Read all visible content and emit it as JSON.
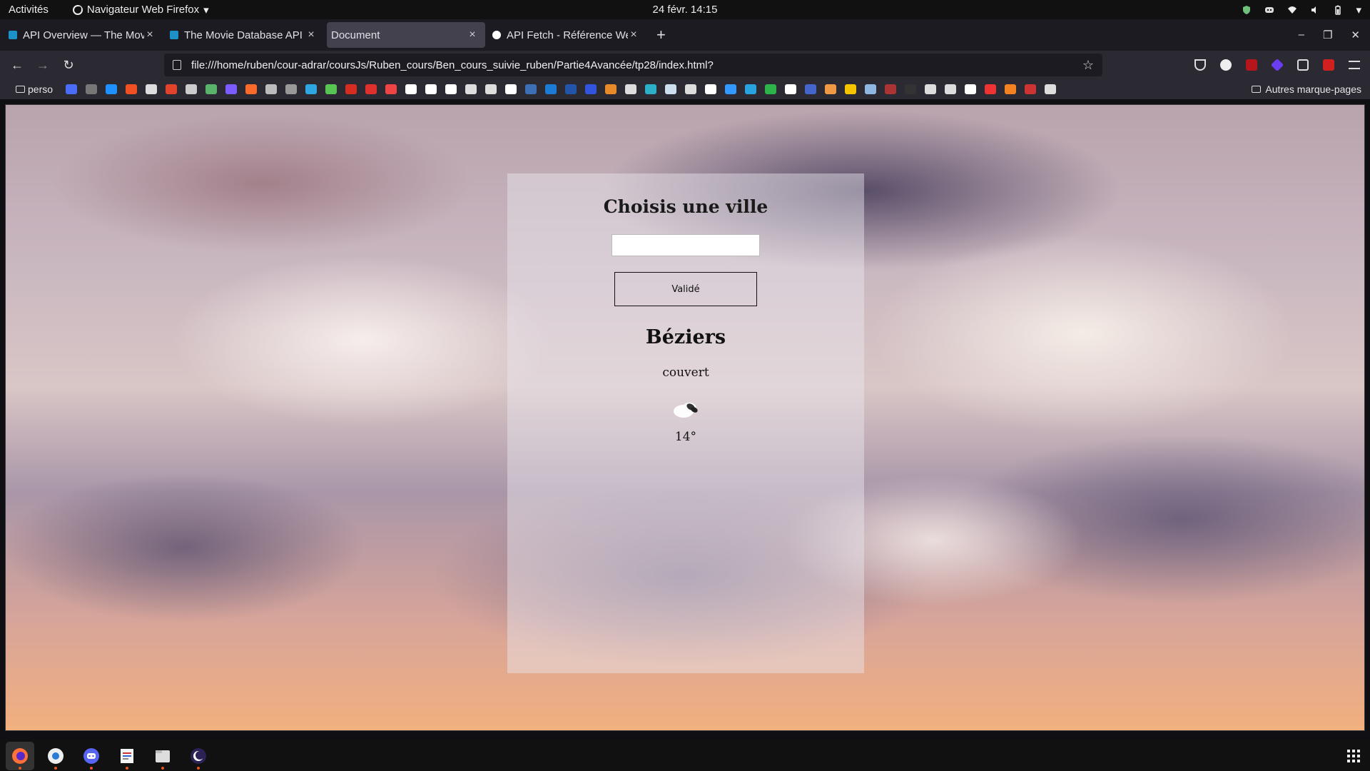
{
  "topbar": {
    "activities": "Activités",
    "app_menu": "Navigateur Web Firefox",
    "clock": "24 févr.  14:15"
  },
  "tabs": [
    {
      "title": "API Overview — The Mov",
      "active": false,
      "favicon_color": "#1e90c8"
    },
    {
      "title": "The Movie Database API",
      "active": false,
      "favicon_color": "#1e90c8"
    },
    {
      "title": "Document",
      "active": true,
      "favicon_color": ""
    },
    {
      "title": "API Fetch - Référence We",
      "active": false,
      "favicon_color": "#ffffff"
    }
  ],
  "navbar": {
    "url": "file:///home/ruben/cour-adrar/coursJs/Ruben_cours/Ben_cours_suivie_ruben/Partie4Avancée/tp28/index.html?"
  },
  "bookmarks": {
    "folder_label": "perso",
    "other_label": "Autres marque-pages",
    "icon_colors": [
      "#4a6cf7",
      "#777",
      "#1e90ff",
      "#f25022",
      "#ddd",
      "#e2432a",
      "#ccc",
      "#59b36b",
      "#7c5cff",
      "#f96b2b",
      "#bbb",
      "#999",
      "#2ea7e0",
      "#58c452",
      "#d62d20",
      "#e0302c",
      "#e44",
      "#fff",
      "#fff",
      "#fff",
      "#ddd",
      "#ddd",
      "#fff",
      "#3b6fb6",
      "#1c7bd4",
      "#25a",
      "#3355dd",
      "#e88a2a",
      "#ddd",
      "#2bb0c8",
      "#cde",
      "#ddd",
      "#fff",
      "#3399ff",
      "#29a3e0",
      "#2cb34a",
      "#fff",
      "#4466cc",
      "#e94",
      "#f5c400",
      "#8fb7e0",
      "#a33",
      "#333",
      "#ddd",
      "#ddd",
      "#fff",
      "#e33",
      "#f58220",
      "#c33",
      "#ddd"
    ]
  },
  "content": {
    "heading": "Choisis une ville",
    "input_value": "",
    "input_placeholder": "",
    "button_label": "Validé",
    "city": "Béziers",
    "description": "couvert",
    "weather_icon": "broken-clouds-icon",
    "temperature": "14°"
  },
  "dock": {
    "apps": [
      "firefox-icon",
      "settings-icon",
      "discord-icon",
      "text-editor-icon",
      "files-icon",
      "eclipse-icon"
    ]
  }
}
